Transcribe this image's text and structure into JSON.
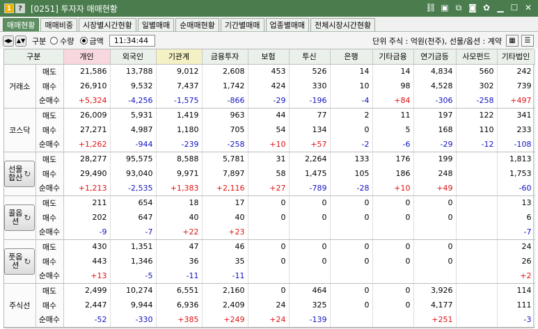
{
  "window": {
    "badge_num": "1",
    "badge_help": "?",
    "title": "[0251] 투자자 매매현황",
    "icons": [
      "link-icon",
      "window-icon",
      "copy-icon",
      "camera-icon",
      "gear-icon",
      "minimize-icon",
      "maximize-icon",
      "close-icon"
    ]
  },
  "tabs": [
    "매매현황",
    "매매비중",
    "시장별시간현황",
    "일별매매",
    "순매매현황",
    "기간별매매",
    "업종별매매",
    "전체시장시간현황"
  ],
  "active_tab": 0,
  "toolbar": {
    "label_gubun": "구분",
    "radio_qty": "수량",
    "radio_amount": "금액",
    "selected": "금액",
    "time": "11:34:44",
    "unit_text": "단위 주식 : 억원(천주), 선물/옵션 : 계약"
  },
  "columns": [
    "구분",
    "개인",
    "외국인",
    "기관계",
    "금융투자",
    "보험",
    "투신",
    "은행",
    "기타금융",
    "연기금등",
    "사모펀드",
    "기타법인"
  ],
  "row_labels": [
    "매도",
    "매수",
    "순매수"
  ],
  "groups": [
    {
      "name": "거래소",
      "button": false,
      "rows": [
        [
          "21,586",
          "13,788",
          "9,012",
          "2,608",
          "453",
          "526",
          "14",
          "14",
          "4,834",
          "560",
          "242"
        ],
        [
          "26,910",
          "9,532",
          "7,437",
          "1,742",
          "424",
          "330",
          "10",
          "98",
          "4,528",
          "302",
          "739"
        ],
        [
          "+5,324",
          "-4,256",
          "-1,575",
          "-866",
          "-29",
          "-196",
          "-4",
          "+84",
          "-306",
          "-258",
          "+497"
        ]
      ]
    },
    {
      "name": "코스닥",
      "button": false,
      "rows": [
        [
          "26,009",
          "5,931",
          "1,419",
          "963",
          "44",
          "77",
          "2",
          "11",
          "197",
          "122",
          "341"
        ],
        [
          "27,271",
          "4,987",
          "1,180",
          "705",
          "54",
          "134",
          "0",
          "5",
          "168",
          "110",
          "233"
        ],
        [
          "+1,262",
          "-944",
          "-239",
          "-258",
          "+10",
          "+57",
          "-2",
          "-6",
          "-29",
          "-12",
          "-108"
        ]
      ]
    },
    {
      "name": "선물합산",
      "button": true,
      "rows": [
        [
          "28,277",
          "95,575",
          "8,588",
          "5,781",
          "31",
          "2,264",
          "133",
          "176",
          "199",
          "",
          "1,813"
        ],
        [
          "29,490",
          "93,040",
          "9,971",
          "7,897",
          "58",
          "1,475",
          "105",
          "186",
          "248",
          "",
          "1,753"
        ],
        [
          "+1,213",
          "-2,535",
          "+1,383",
          "+2,116",
          "+27",
          "-789",
          "-28",
          "+10",
          "+49",
          "",
          "-60"
        ]
      ]
    },
    {
      "name": "콜옵션",
      "button": true,
      "rows": [
        [
          "211",
          "654",
          "18",
          "17",
          "0",
          "0",
          "0",
          "0",
          "0",
          "",
          "13"
        ],
        [
          "202",
          "647",
          "40",
          "40",
          "0",
          "0",
          "0",
          "0",
          "0",
          "",
          "6"
        ],
        [
          "-9",
          "-7",
          "+22",
          "+23",
          "",
          "",
          "",
          "",
          "",
          "",
          "-7"
        ]
      ]
    },
    {
      "name": "풋옵션",
      "button": true,
      "rows": [
        [
          "430",
          "1,351",
          "47",
          "46",
          "0",
          "0",
          "0",
          "0",
          "0",
          "",
          "24"
        ],
        [
          "443",
          "1,346",
          "36",
          "35",
          "0",
          "0",
          "0",
          "0",
          "0",
          "",
          "26"
        ],
        [
          "+13",
          "-5",
          "-11",
          "-11",
          "",
          "",
          "",
          "",
          "",
          "",
          "+2"
        ]
      ]
    },
    {
      "name": "주식선",
      "button": false,
      "rows": [
        [
          "2,499",
          "10,274",
          "6,551",
          "2,160",
          "0",
          "464",
          "0",
          "0",
          "3,926",
          "",
          "114"
        ],
        [
          "2,447",
          "9,944",
          "6,936",
          "2,409",
          "24",
          "325",
          "0",
          "0",
          "4,177",
          "",
          "111"
        ],
        [
          "-52",
          "-330",
          "+385",
          "+249",
          "+24",
          "-139",
          "",
          "",
          "+251",
          "",
          "-3"
        ]
      ]
    }
  ],
  "colors": {
    "title_bar": "#4a7c4e",
    "positive": "#e01010",
    "negative": "#1010c0",
    "header_individual": "#f8d8de",
    "header_institution": "#f4f2c4"
  }
}
